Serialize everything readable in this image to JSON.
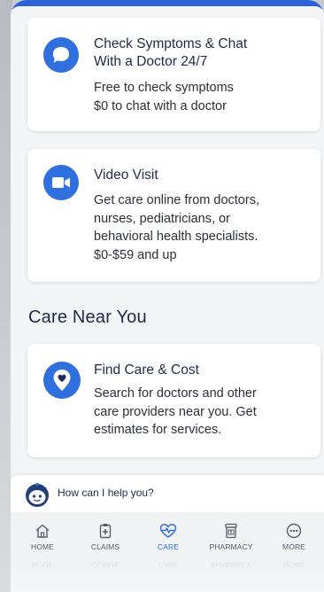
{
  "cards": [
    {
      "title_line1": "Check Symptoms & Chat",
      "title_line2": "With a Doctor 24/7",
      "text": "Free to check symptoms\n$0 to chat with a doctor",
      "icon": "chat-bubble-icon"
    },
    {
      "title": "Video Visit",
      "text": "Get care online from doctors,\nnurses, pediatricians, or\nbehavioral health specialists.\n$0-$59 and up",
      "icon": "video-camera-icon"
    }
  ],
  "section": {
    "heading": "Care Near You"
  },
  "find_card": {
    "title": "Find Care & Cost",
    "text": "Search for doctors and other\ncare providers near you. Get\nestimates for services.",
    "icon": "location-heart-icon"
  },
  "assistant": {
    "prompt": "How can I help you?"
  },
  "tabs": [
    {
      "label": "HOME",
      "icon": "home-icon"
    },
    {
      "label": "CLAIMS",
      "icon": "clipboard-icon"
    },
    {
      "label": "CARE",
      "icon": "heart-pulse-icon",
      "active": true
    },
    {
      "label": "PHARMACY",
      "icon": "pill-bottle-icon"
    },
    {
      "label": "MORE",
      "icon": "more-dots-icon"
    }
  ],
  "colors": {
    "accent": "#2f6fde",
    "text_dark": "#1f2a44"
  }
}
